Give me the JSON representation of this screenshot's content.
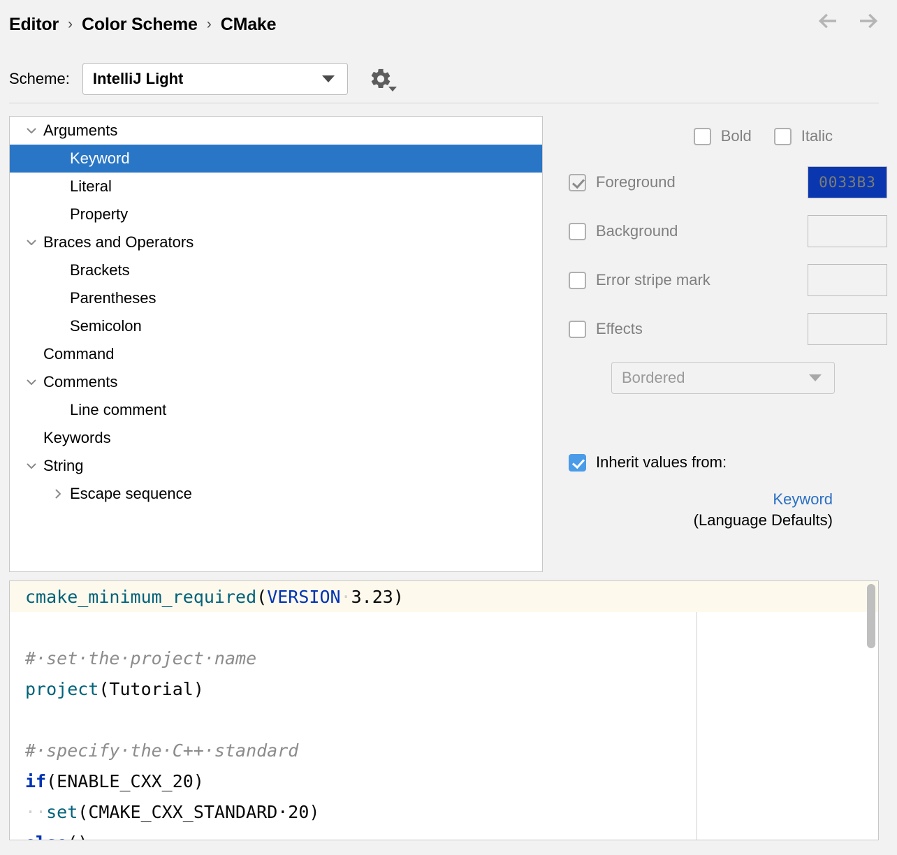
{
  "breadcrumb": {
    "items": [
      "Editor",
      "Color Scheme",
      "CMake"
    ],
    "separator": "›",
    "back_icon": "arrow-left-icon",
    "forward_icon": "arrow-right-icon"
  },
  "scheme": {
    "label": "Scheme:",
    "value": "IntelliJ Light",
    "gear_icon": "gear-icon",
    "dropdown_icon": "chevron-down-icon"
  },
  "tree": {
    "expanded_icon": "chevron-down-icon",
    "collapsed_icon": "chevron-right-icon",
    "selected": "Keyword",
    "items": [
      {
        "label": "Arguments",
        "depth": 0,
        "toggle": "expanded",
        "selected": false
      },
      {
        "label": "Keyword",
        "depth": 1,
        "toggle": "none",
        "selected": true
      },
      {
        "label": "Literal",
        "depth": 1,
        "toggle": "none",
        "selected": false
      },
      {
        "label": "Property",
        "depth": 1,
        "toggle": "none",
        "selected": false
      },
      {
        "label": "Braces and Operators",
        "depth": 0,
        "toggle": "expanded",
        "selected": false
      },
      {
        "label": "Brackets",
        "depth": 1,
        "toggle": "none",
        "selected": false
      },
      {
        "label": "Parentheses",
        "depth": 1,
        "toggle": "none",
        "selected": false
      },
      {
        "label": "Semicolon",
        "depth": 1,
        "toggle": "none",
        "selected": false
      },
      {
        "label": "Command",
        "depth": 0,
        "toggle": "none",
        "selected": false
      },
      {
        "label": "Comments",
        "depth": 0,
        "toggle": "expanded",
        "selected": false
      },
      {
        "label": "Line comment",
        "depth": 1,
        "toggle": "none",
        "selected": false
      },
      {
        "label": "Keywords",
        "depth": 0,
        "toggle": "none",
        "selected": false
      },
      {
        "label": "String",
        "depth": 0,
        "toggle": "expanded",
        "selected": false
      },
      {
        "label": "Escape sequence",
        "depth": 1,
        "toggle": "collapsed",
        "selected": false
      }
    ]
  },
  "attributes": {
    "bold": {
      "label": "Bold",
      "checked": false,
      "enabled": false
    },
    "italic": {
      "label": "Italic",
      "checked": false,
      "enabled": false
    },
    "foreground": {
      "label": "Foreground",
      "checked": true,
      "enabled": false,
      "color": "0033B3",
      "swatch_hex": "#0A37B0"
    },
    "background": {
      "label": "Background",
      "checked": false,
      "enabled": false,
      "color": ""
    },
    "error_stripe_mark": {
      "label": "Error stripe mark",
      "checked": false,
      "enabled": false,
      "color": ""
    },
    "effects": {
      "label": "Effects",
      "checked": false,
      "enabled": false,
      "color": ""
    },
    "effect_type": {
      "value": "Bordered",
      "enabled": false,
      "dropdown_icon": "chevron-down-icon"
    },
    "inherit": {
      "label": "Inherit values from:",
      "checked": true,
      "target_link": "Keyword",
      "target_source": "(Language Defaults)"
    }
  },
  "preview": {
    "caret_line_index": 0,
    "lines": [
      {
        "tokens": [
          {
            "t": "cmake_minimum_required",
            "c": "fn"
          },
          {
            "t": "(",
            "c": "plain"
          },
          {
            "t": "VERSION",
            "c": "kw-plain"
          },
          {
            "t": "·",
            "c": "ws"
          },
          {
            "t": "3.23)",
            "c": "plain"
          }
        ]
      },
      {
        "tokens": []
      },
      {
        "tokens": [
          {
            "t": "#·set·the·project·name",
            "c": "comment"
          }
        ]
      },
      {
        "tokens": [
          {
            "t": "project",
            "c": "fn"
          },
          {
            "t": "(Tutorial)",
            "c": "plain"
          }
        ]
      },
      {
        "tokens": []
      },
      {
        "tokens": [
          {
            "t": "#·specify·the·C++·standard",
            "c": "comment"
          }
        ]
      },
      {
        "tokens": [
          {
            "t": "if",
            "c": "kw"
          },
          {
            "t": "(ENABLE_CXX_20)",
            "c": "plain"
          }
        ]
      },
      {
        "tokens": [
          {
            "t": "··",
            "c": "ws"
          },
          {
            "t": "set",
            "c": "fn"
          },
          {
            "t": "(CMAKE_CXX_STANDARD·20)",
            "c": "plain"
          }
        ]
      },
      {
        "tokens": [
          {
            "t": "else",
            "c": "kw"
          },
          {
            "t": "()",
            "c": "plain"
          }
        ]
      }
    ],
    "scrollbar": {
      "visible": true
    }
  }
}
